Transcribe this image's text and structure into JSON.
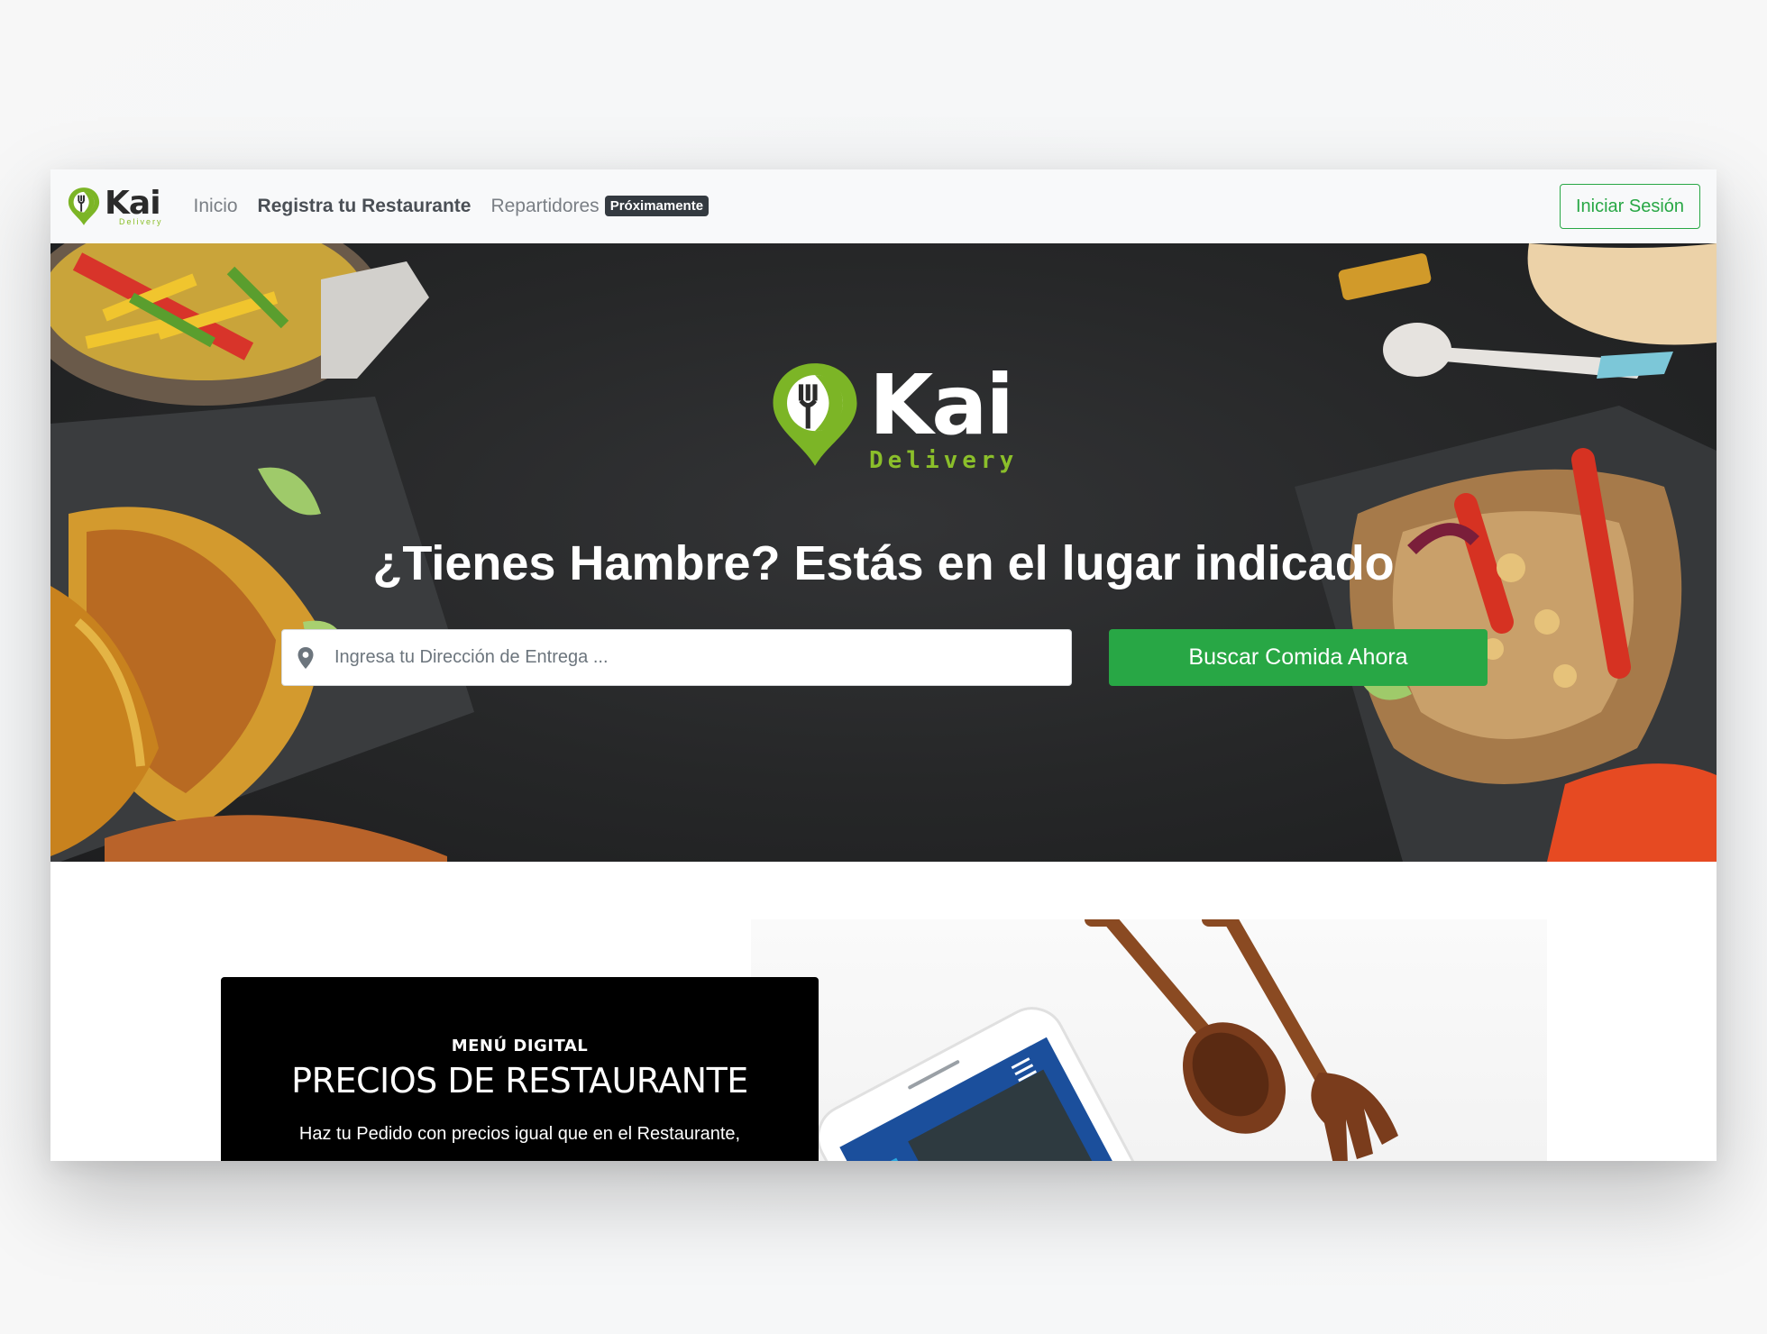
{
  "brand": {
    "name": "Kai",
    "tagline": "Delivery",
    "accent": "#8bbf2a"
  },
  "nav": {
    "items": [
      {
        "label": "Inicio",
        "active": false
      },
      {
        "label": "Registra tu Restaurante",
        "active": true
      },
      {
        "label": "Repartidores",
        "active": false
      }
    ],
    "badge": "Próximamente",
    "login_label": "Iniciar Sesión"
  },
  "hero": {
    "title": "¿Tienes Hambre? Estás en el lugar indicado",
    "search_placeholder": "Ingresa tu Dirección de Entrega ...",
    "search_button": "Buscar Comida Ahora",
    "pin_icon": "map-pin-icon"
  },
  "feature": {
    "kicker": "MENÚ DIGITAL",
    "title": "PRECIOS DE RESTAURANTE",
    "text": "Haz tu Pedido con precios igual que en el Restaurante,"
  },
  "colors": {
    "primary": "#28a745",
    "dark": "#343a40",
    "hero_bg": "#262728"
  }
}
